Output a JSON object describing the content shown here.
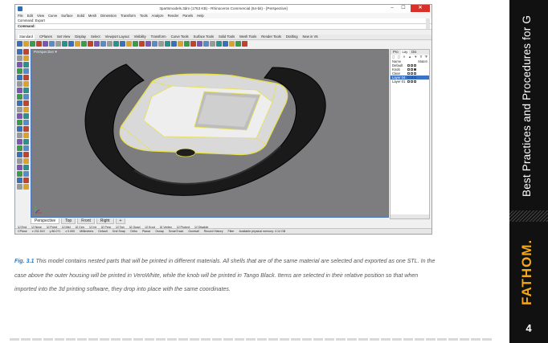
{
  "screenshot": {
    "title": "3partsmodels.3dm (1763 KB) - Rhinoceros Commercial (64-bit) - [Perspective]",
    "window_buttons": [
      "–",
      "☐",
      "✕"
    ],
    "menu": [
      "File",
      "Edit",
      "View",
      "Curve",
      "Surface",
      "Solid",
      "Mesh",
      "Dimension",
      "Transform",
      "Tools",
      "Analyze",
      "Render",
      "Panels",
      "Help"
    ],
    "command_history": "Command: Export",
    "command_prompt": "Command:",
    "toolbar_tabs": [
      "Standard",
      "CPlanes",
      "Set View",
      "Display",
      "Select",
      "Viewport Layout",
      "Visibility",
      "Transform",
      "Curve Tools",
      "Surface Tools",
      "Solid Tools",
      "Mesh Tools",
      "Render Tools",
      "Drafting",
      "New in V5"
    ],
    "viewport_label": "Perspective",
    "viewport_tabs": [
      "Perspective",
      "Top",
      "Front",
      "Right",
      "+"
    ],
    "osnaps": [
      "End",
      "Near",
      "Point",
      "Mid",
      "Cen",
      "Int",
      "Perp",
      "Tan",
      "Quad",
      "Knot",
      "Vertex",
      "Project",
      "Disable"
    ],
    "status_bar": [
      "CPlane",
      "x 231.519",
      "y 86.071",
      "z 0.000",
      "Millimeters",
      "Default",
      "Grid Snap",
      "Ortho",
      "Planar",
      "Osnap",
      "SmartTrack",
      "Gumball",
      "Record History",
      "Filter",
      "Available physical memory: 4.14 GB"
    ],
    "panel_tabs": [
      "Pro",
      "Lay",
      "Dis"
    ],
    "panel_toolbar": "◻ ◻ ✕ ▲ ▼ ∇ ⧩",
    "layer_headers": {
      "name": "Name",
      "material": "Materi"
    },
    "layers": [
      {
        "name": "Default",
        "color": "#ffffff",
        "selected": false
      },
      {
        "name": "Knob",
        "color": "#111111",
        "selected": false
      },
      {
        "name": "Clear",
        "color": "#ffffff",
        "selected": false
      },
      {
        "name": "Layer 04",
        "color": "#3d73c5",
        "selected": true
      },
      {
        "name": "Layer 01",
        "color": "#ffffff",
        "selected": false
      }
    ]
  },
  "caption": {
    "label": "Fig. 3.1",
    "text": "This model contains nested parts that will be printed in different materials. All shells that are of the same material are selected and exported as one STL. In the case above the outer housing will be printed in VeroWhite, while the knob will be printed in Tango Black. Items are selected in their relative position so that when imported into the 3d printing software, they drop into place with the same coordinates."
  },
  "sidebar": {
    "title": "Best Practices and Procedures for G",
    "logo": "FATHOM.",
    "page_number": "4"
  },
  "colors": {
    "accent_blue": "#2a7abf",
    "logo_orange": "#f2a81d",
    "sidebar_bg": "#111111",
    "viewport_bg": "#7d7d7f",
    "selection_yellow": "#e8e04a"
  }
}
